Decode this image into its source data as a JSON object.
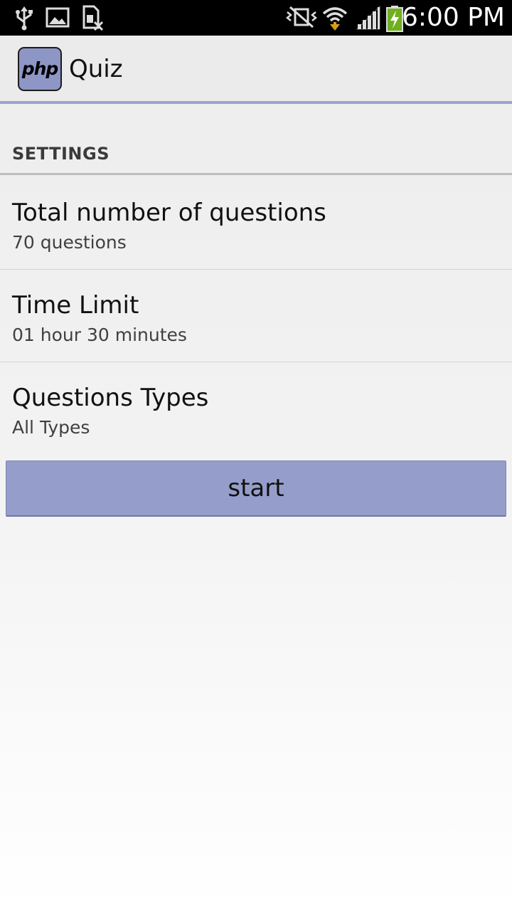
{
  "status_bar": {
    "time": "6:00 PM",
    "icons": [
      "usb-icon",
      "image-icon",
      "no-sim-icon",
      "vibrate-silent-icon",
      "wifi-icon",
      "signal-icon",
      "battery-charging-icon"
    ]
  },
  "action_bar": {
    "app_icon_text": "php",
    "title": "Quiz"
  },
  "settings": {
    "header": "SETTINGS",
    "items": [
      {
        "title": "Total number of questions",
        "summary": "70 questions"
      },
      {
        "title": "Time Limit",
        "summary": "01 hour 30 minutes"
      },
      {
        "title": "Questions Types",
        "summary": "All Types"
      }
    ]
  },
  "start_button": {
    "label": "start"
  },
  "colors": {
    "accent": "#959ecb",
    "action_bar_divider": "#9ba3cc",
    "status_bar": "#000000"
  }
}
